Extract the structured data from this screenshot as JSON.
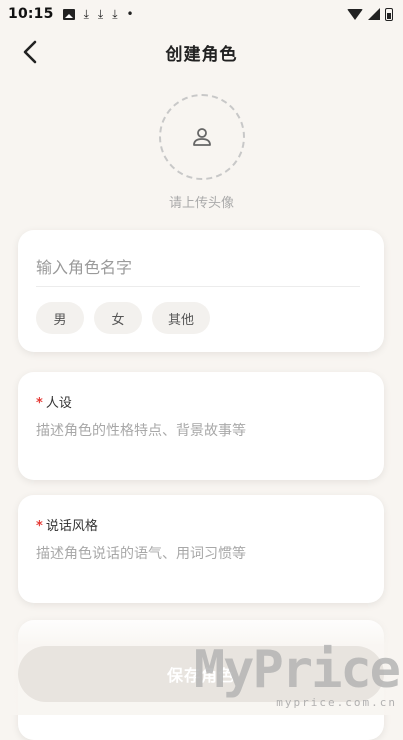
{
  "status_bar": {
    "time": "10:15",
    "icons": [
      "image-icon",
      "download-icon",
      "download-icon",
      "download-icon",
      "dot-icon",
      "wifi-icon",
      "signal-icon",
      "battery-icon"
    ]
  },
  "nav": {
    "back_icon": "chevron-left-icon",
    "title": "创建角色"
  },
  "avatar": {
    "icon": "user-icon",
    "label": "请上传头像"
  },
  "name_card": {
    "name_placeholder": "输入角色名字",
    "gender_options": [
      "男",
      "女",
      "其他"
    ]
  },
  "persona_field": {
    "required_mark": "*",
    "label": "人设",
    "placeholder": "描述角色的性格特点、背景故事等"
  },
  "speaking_style_field": {
    "required_mark": "*",
    "label": "说话风格",
    "placeholder": "描述角色说话的语气、用词习惯等"
  },
  "save_button": {
    "label": "保存角色"
  },
  "watermark": {
    "main": "MyPrice",
    "sub": "myprice.com.cn"
  },
  "colors": {
    "background": "#f8f5f1",
    "required": "#e53935",
    "save_button_bg": "#e8e4df"
  }
}
